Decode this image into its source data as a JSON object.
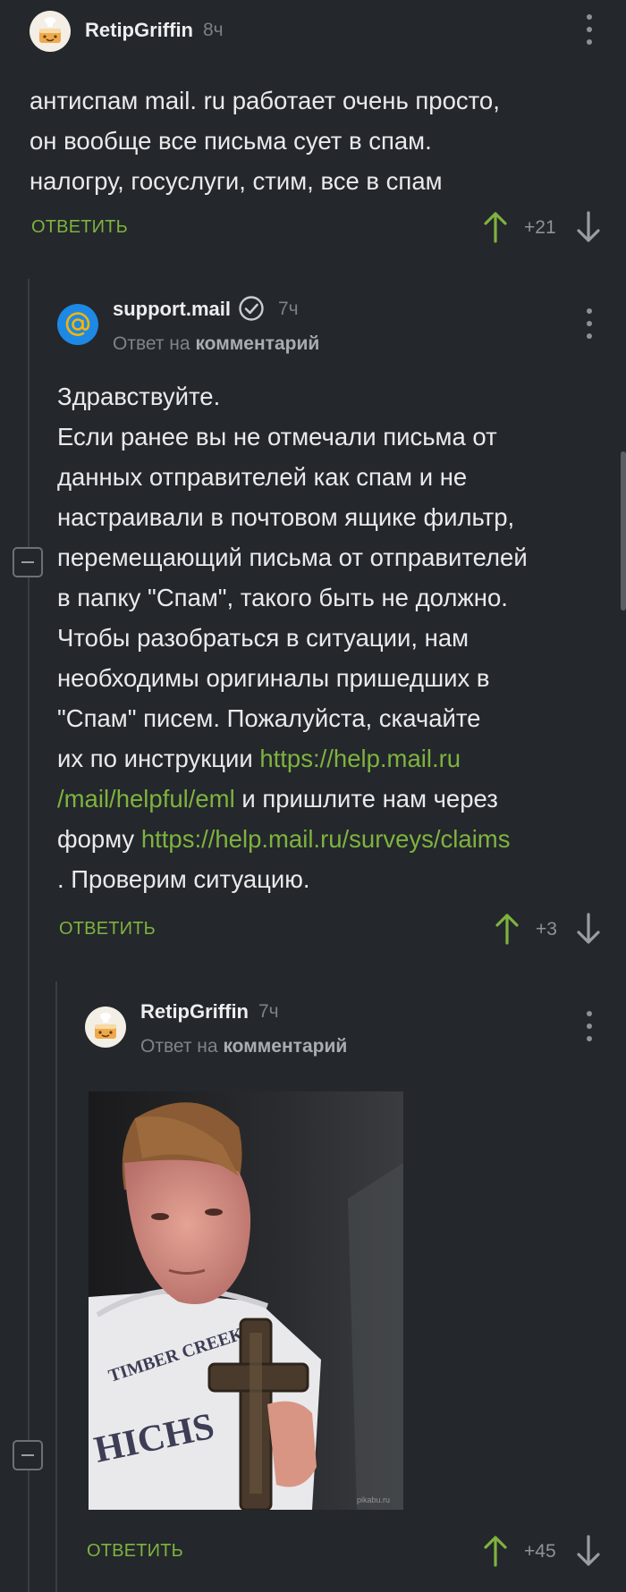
{
  "comments": [
    {
      "username": "RetipGriffin",
      "time": "8ч",
      "lines": [
        "антиспам mail. ru работает очень просто,",
        "он вообще все письма сует в спам.",
        "налогру, госуслуги, стим, все в спам"
      ],
      "reply_label": "ОТВЕТИТЬ",
      "score": "+21"
    },
    {
      "username": "support.mail",
      "time": "7ч",
      "reply_prefix": "Ответ на",
      "reply_target": "комментарий",
      "text": {
        "l1": "Здравствуйте.",
        "l2": "Если ранее вы не отмечали письма от",
        "l3": "данных отправителей как спам и не",
        "l4": "настраивали в почтовом ящике фильтр,",
        "l5": "перемещающий письма от отправителей",
        "l6": "в папку \"Спам\", такого быть не должно.",
        "l7": "Чтобы разобраться в ситуации, нам",
        "l8": "необходимы оригиналы пришедших в",
        "l9": "\"Спам\" писем. Пожалуйста, скачайте",
        "l10_text": "их по инструкции ",
        "l10_link": "https://help.mail.ru",
        "l11_link": "/mail/helpful/eml",
        "l11_text": " и пришлите нам через",
        "l12_text": "форму ",
        "l12_link": "https://help.mail.ru/surveys/claims",
        "l13": ". Проверим ситуацию."
      },
      "reply_label": "ОТВЕТИТЬ",
      "score": "+3"
    },
    {
      "username": "RetipGriffin",
      "time": "7ч",
      "reply_prefix": "Ответ на",
      "reply_target": "комментарий",
      "reply_label": "ОТВЕТИТЬ",
      "score": "+45"
    }
  ],
  "photo": {
    "shirt_text": "TIMBER CREEK H",
    "shirt_text2": "HICHS",
    "watermark": "pikabu.ru"
  },
  "colors": {
    "background": "#24272b",
    "accent_green": "#7eb33f",
    "muted": "#8f9398"
  }
}
